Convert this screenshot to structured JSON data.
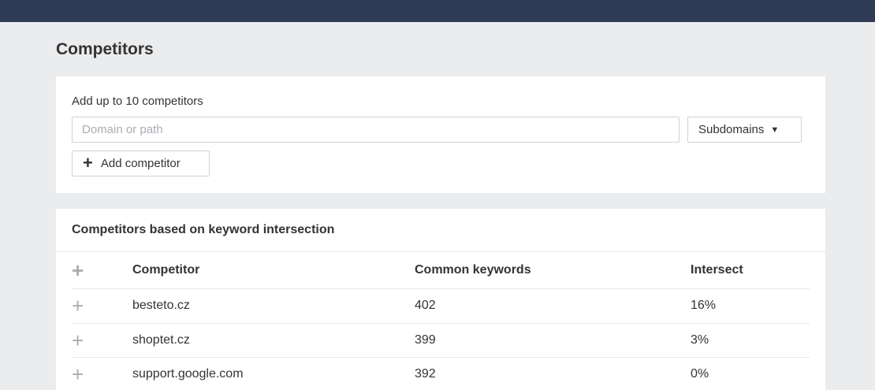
{
  "page": {
    "title": "Competitors"
  },
  "add_card": {
    "label": "Add up to 10 competitors",
    "input_placeholder": "Domain or path",
    "input_value": "",
    "select_value": "Subdomains",
    "add_button_label": "Add competitor"
  },
  "list_card": {
    "title": "Competitors based on keyword intersection",
    "columns": {
      "competitor": "Competitor",
      "common_keywords": "Common keywords",
      "intersect": "Intersect"
    },
    "rows": [
      {
        "competitor": "besteto.cz",
        "common_keywords": "402",
        "intersect": "16%"
      },
      {
        "competitor": "shoptet.cz",
        "common_keywords": "399",
        "intersect": "3%"
      },
      {
        "competitor": "support.google.com",
        "common_keywords": "392",
        "intersect": "0%"
      }
    ]
  },
  "icons": {
    "add": "plus-icon",
    "select": "caret-down-icon"
  },
  "colors": {
    "topbar": "#2e3a56",
    "background": "#ebecee",
    "card": "#ffffff"
  }
}
